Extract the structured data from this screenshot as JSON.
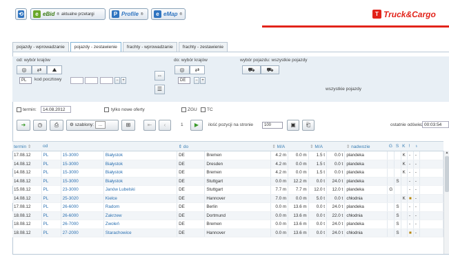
{
  "topbar": {
    "back_label": "⟲",
    "ebid_label": "eBid",
    "ebid_reg": "®",
    "ebid_suffix": "aktualne przetargi",
    "profile_label": "Profile",
    "profile_reg": "®",
    "emap_label": "eMap",
    "emap_reg": "®",
    "brand": "Truck&Cargo",
    "brand_color": "#e2231a"
  },
  "tabs": [
    "pojazdy - wprowadzanie",
    "pojazdy - zestawienie",
    "frachty - wprowadzanie",
    "frachty - zestawienie"
  ],
  "active_tab": 1,
  "filters": {
    "od_label": "od: wybór krajów",
    "do_label": "do: wybór krajów",
    "pojazd_label": "wybór pojazdu: wszystkie pojazdy",
    "od_country": "PL",
    "do_country": "DE",
    "kod_label": "kod pocztowy",
    "wszystkie_pojazdy": "wszystkie pojazdy",
    "termin_label": "termin:",
    "termin_value": "14.08.2012",
    "tylko_label": "tylko nowe oferty",
    "zgu_label": "ZGU",
    "tc_label": "TC"
  },
  "toolbar": {
    "szablony_label": "szablony:",
    "szablony_value": "...",
    "page_num": "1",
    "ilosc_label": "ilość pozycji na stronie",
    "ilosc_value": "100",
    "ostatnie_label": "ostatnie odświeżanie:",
    "ostatnie_value": "00:03:54"
  },
  "columns": [
    "termin",
    "od",
    "do",
    "M/A",
    "M/A",
    "nadwozie",
    "G",
    "S",
    "K",
    "!",
    "♁"
  ],
  "rows": [
    {
      "termin": "17.08.12",
      "c1": "PL",
      "z1": "15-3000",
      "m1": "Białystok",
      "c2": "DE",
      "m2": "Bremen",
      "l": "4.2 m",
      "w": "0.0 m",
      "t": "1.5 t",
      "t2": "0.0 t",
      "nad": "plandeka",
      "g": "",
      "s": "",
      "k": "K",
      "x": "-",
      "y": "-"
    },
    {
      "termin": "14.08.12",
      "c1": "PL",
      "z1": "15-3000",
      "m1": "Białystok",
      "c2": "DE",
      "m2": "Dresden",
      "l": "4.2 m",
      "w": "0.0 m",
      "t": "1.5 t",
      "t2": "0.0 t",
      "nad": "plandeka",
      "g": "",
      "s": "",
      "k": "K",
      "x": "-",
      "y": "-"
    },
    {
      "termin": "14.08.12",
      "c1": "PL",
      "z1": "15-3000",
      "m1": "Białystok",
      "c2": "DE",
      "m2": "Bremen",
      "l": "4.2 m",
      "w": "0.0 m",
      "t": "1.5 t",
      "t2": "0.0 t",
      "nad": "plandeka",
      "g": "",
      "s": "",
      "k": "K",
      "x": "-",
      "y": "-"
    },
    {
      "termin": "14.08.12",
      "c1": "PL",
      "z1": "15-3000",
      "m1": "Białystok",
      "c2": "DE",
      "m2": "Stuttgart",
      "l": "0.0 m",
      "w": "12.2 m",
      "t": "0.0 t",
      "t2": "24.0 t",
      "nad": "plandeka",
      "g": "",
      "s": "S",
      "k": "",
      "x": "-",
      "y": "-"
    },
    {
      "termin": "15.08.12",
      "c1": "PL",
      "z1": "23-3000",
      "m1": "Janów Lubelski",
      "c2": "DE",
      "m2": "Stuttgart",
      "l": "7.7 m",
      "w": "7.7 m",
      "t": "12.0 t",
      "t2": "12.0 t",
      "nad": "plandeka",
      "g": "G",
      "s": "",
      "k": "",
      "x": "-",
      "y": "-"
    },
    {
      "termin": "14.08.12",
      "c1": "PL",
      "z1": "25-3020",
      "m1": "Kielce",
      "c2": "DE",
      "m2": "Hannover",
      "l": "7.0 m",
      "w": "0.0 m",
      "t": "5.0 t",
      "t2": "0.0 t",
      "nad": "chłodnia",
      "g": "",
      "s": "",
      "k": "K",
      "x": "■",
      "y": "-"
    },
    {
      "termin": "17.08.12",
      "c1": "PL",
      "z1": "26-6000",
      "m1": "Radom",
      "c2": "DE",
      "m2": "Berlin",
      "l": "0.0 m",
      "w": "13.6 m",
      "t": "0.0 t",
      "t2": "24.0 t",
      "nad": "plandeka",
      "g": "",
      "s": "S",
      "k": "",
      "x": "-",
      "y": "-"
    },
    {
      "termin": "18.08.12",
      "c1": "PL",
      "z1": "26-6000",
      "m1": "Zakrzew",
      "c2": "DE",
      "m2": "Dortmund",
      "l": "0.0 m",
      "w": "13.6 m",
      "t": "0.0 t",
      "t2": "22.0 t",
      "nad": "chłodnia",
      "g": "",
      "s": "S",
      "k": "",
      "x": "-",
      "y": "-"
    },
    {
      "termin": "18.08.12",
      "c1": "PL",
      "z1": "26-7000",
      "m1": "Zwoleń",
      "c2": "DE",
      "m2": "Bremen",
      "l": "0.0 m",
      "w": "13.6 m",
      "t": "0.0 t",
      "t2": "24.0 t",
      "nad": "plandeka",
      "g": "",
      "s": "S",
      "k": "",
      "x": "-",
      "y": "-"
    },
    {
      "termin": "18.08.12",
      "c1": "PL",
      "z1": "27-2000",
      "m1": "Starachowice",
      "c2": "DE",
      "m2": "Hannover",
      "l": "0.0 m",
      "w": "13.6 m",
      "t": "0.0 t",
      "t2": "24.0 t",
      "nad": "chłodnia",
      "g": "",
      "s": "S",
      "k": "",
      "x": "■",
      "y": "-"
    }
  ]
}
